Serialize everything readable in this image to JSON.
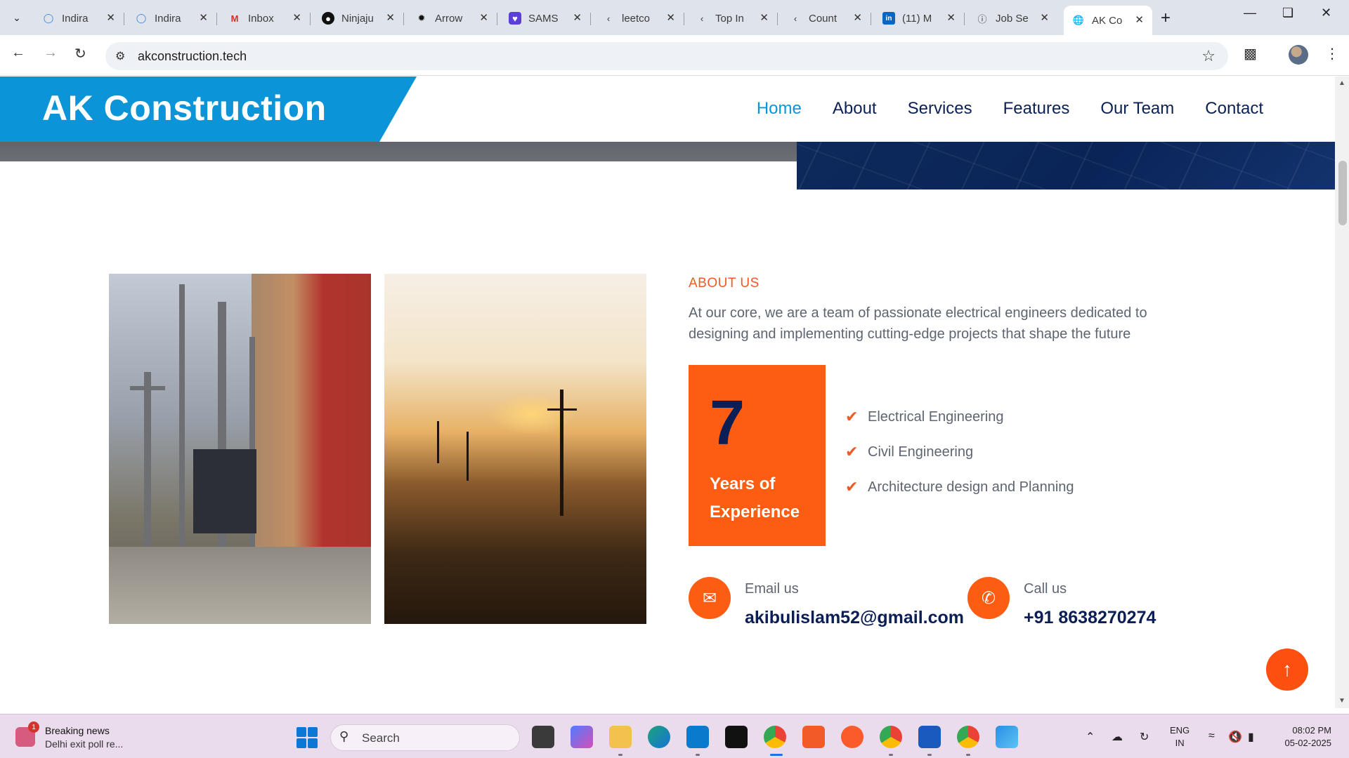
{
  "browser": {
    "tabs": [
      {
        "title": "Indira",
        "favicon": "indira-icon",
        "color": "#3b82d6"
      },
      {
        "title": "Indira",
        "favicon": "indira-icon",
        "color": "#3b82d6"
      },
      {
        "title": "Inbox",
        "favicon": "gmail-icon",
        "color": "#d93025"
      },
      {
        "title": "Ninjaju",
        "favicon": "github-icon",
        "color": "#111111"
      },
      {
        "title": "Arrow",
        "favicon": "openai-icon",
        "color": "#111111"
      },
      {
        "title": "SAMS",
        "favicon": "samsung-icon",
        "color": "#5b3fd6"
      },
      {
        "title": "leetco",
        "favicon": "leetcode-icon",
        "color": "#333333"
      },
      {
        "title": "Top In",
        "favicon": "leetcode-icon",
        "color": "#333333"
      },
      {
        "title": "Count",
        "favicon": "leetcode-icon",
        "color": "#333333"
      },
      {
        "title": "(11) M",
        "favicon": "linkedin-icon",
        "color": "#0a66c2"
      },
      {
        "title": "Job Se",
        "favicon": "info-icon",
        "color": "#333333"
      },
      {
        "title": "AK Co",
        "favicon": "globe-icon",
        "color": "#333333",
        "active": true
      }
    ],
    "url": "akconstruction.tech"
  },
  "site": {
    "brand": "AK Construction",
    "nav": [
      "Home",
      "About",
      "Services",
      "Features",
      "Our Team",
      "Contact"
    ],
    "active_nav": "Home",
    "about": {
      "label": "ABOUT US",
      "text": "At our core, we are a team of passionate electrical engineers dedicated to designing and implementing cutting-edge projects that shape the future"
    },
    "experience": {
      "number": "7",
      "text": "Years of Experience"
    },
    "features": [
      "Electrical Engineering",
      "Civil Engineering",
      "Architecture design and Planning"
    ],
    "contact": {
      "email_label": "Email us",
      "email": "akibulislam52@gmail.com",
      "phone_label": "Call us",
      "phone": "+91 8638270274"
    },
    "colors": {
      "brand_blue": "#0b95d8",
      "accent_orange": "#fd5c13",
      "navy": "#0b1e55"
    }
  },
  "taskbar": {
    "news_title": "Breaking news",
    "news_sub": "Delhi exit poll re...",
    "news_badge": "1",
    "search_label": "Search",
    "lang_top": "ENG",
    "lang_bottom": "IN",
    "time": "08:02 PM",
    "date": "05-02-2025"
  }
}
